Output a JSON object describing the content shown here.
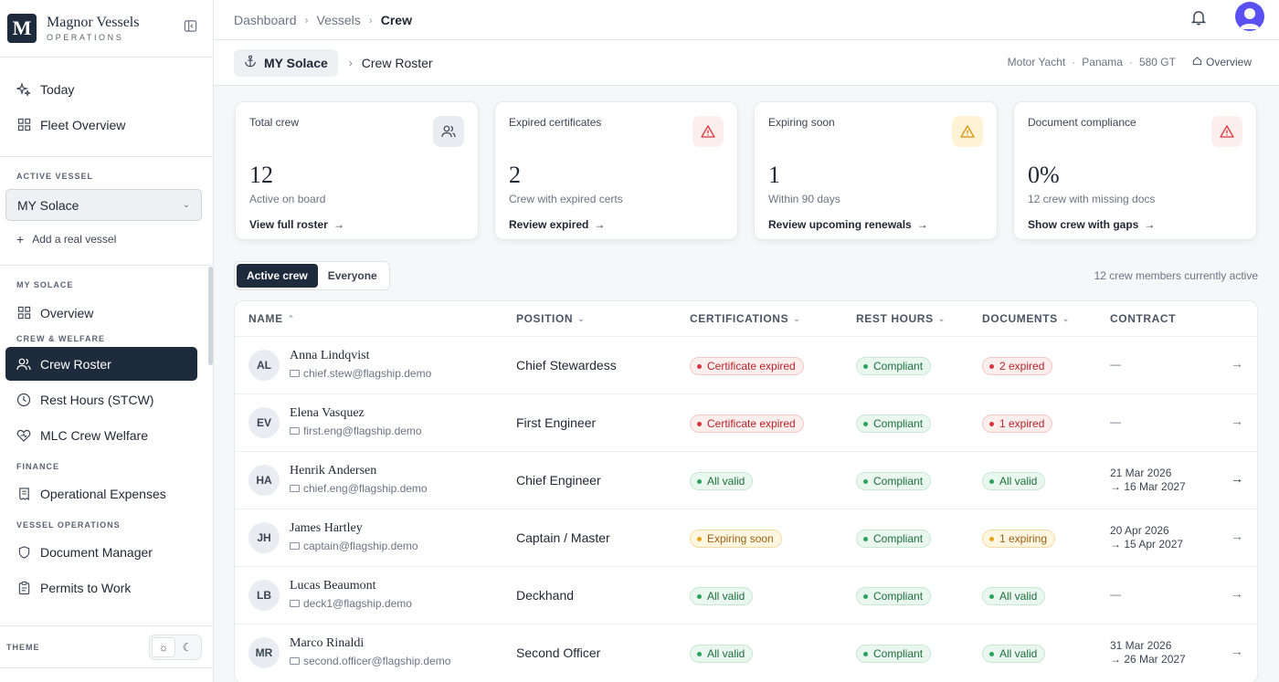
{
  "brand": {
    "name": "Magnor Vessels",
    "sub": "OPERATIONS",
    "logo_letter": "M"
  },
  "sidebar": {
    "top_items": [
      {
        "label": "Today",
        "icon": "sparkle-icon"
      },
      {
        "label": "Fleet Overview",
        "icon": "grid-icon"
      }
    ],
    "active_vessel_label": "ACTIVE VESSEL",
    "active_vessel_value": "MY Solace",
    "add_vessel": "Add a real vessel",
    "sections": [
      {
        "label": "MY SOLACE",
        "items": [
          {
            "label": "Overview",
            "icon": "grid-icon"
          }
        ]
      },
      {
        "label": "CREW & WELFARE",
        "items": [
          {
            "label": "Crew Roster",
            "icon": "users-icon",
            "active": true
          },
          {
            "label": "Rest Hours (STCW)",
            "icon": "clock-icon"
          },
          {
            "label": "MLC Crew Welfare",
            "icon": "heart-icon"
          }
        ]
      },
      {
        "label": "FINANCE",
        "items": [
          {
            "label": "Operational Expenses",
            "icon": "receipt-icon"
          }
        ]
      },
      {
        "label": "VESSEL OPERATIONS",
        "items": [
          {
            "label": "Document Manager",
            "icon": "shield-icon"
          },
          {
            "label": "Permits to Work",
            "icon": "clipboard-icon"
          }
        ]
      }
    ],
    "theme_label": "THEME"
  },
  "topbar": {
    "crumbs": [
      "Dashboard",
      "Vessels",
      "Crew"
    ]
  },
  "subbar": {
    "vessel": "MY Solace",
    "title": "Crew Roster",
    "meta": [
      "Motor Yacht",
      "Panama",
      "580 GT"
    ],
    "overview_link": "Overview"
  },
  "cards": [
    {
      "label": "Total crew",
      "value": "12",
      "sub": "Active on board",
      "link": "View full roster",
      "icon": "users-icon",
      "tone": "#e9edf2"
    },
    {
      "label": "Expired certificates",
      "value": "2",
      "sub": "Crew with expired certs",
      "link": "Review expired",
      "icon": "alert-triangle-icon",
      "tone": "#fdeeee"
    },
    {
      "label": "Expiring soon",
      "value": "1",
      "sub": "Within 90 days",
      "link": "Review upcoming renewals",
      "icon": "alert-triangle-icon",
      "tone": "#fff3d6"
    },
    {
      "label": "Document compliance",
      "value": "0%",
      "sub": "12 crew with missing docs",
      "link": "Show crew with gaps",
      "icon": "alert-triangle-icon",
      "tone": "#fdeeee"
    }
  ],
  "tabs": [
    "Active crew",
    "Everyone"
  ],
  "active_count": "12 crew members currently active",
  "table": {
    "headers": [
      "NAME",
      "POSITION",
      "CERTIFICATIONS",
      "REST HOURS",
      "DOCUMENTS",
      "CONTRACT"
    ],
    "rows": [
      {
        "initials": "AL",
        "name": "Anna Lindqvist",
        "email": "chief.stew@flagship.demo",
        "position": "Chief Stewardess",
        "cert": "Certificate expired",
        "cert_tone": "red",
        "rest": "Compliant",
        "docs": "2 expired",
        "docs_tone": "red",
        "contract_start": "",
        "contract_end": "",
        "contract_dash": "—"
      },
      {
        "initials": "EV",
        "name": "Elena Vasquez",
        "email": "first.eng@flagship.demo",
        "position": "First Engineer",
        "cert": "Certificate expired",
        "cert_tone": "red",
        "rest": "Compliant",
        "docs": "1 expired",
        "docs_tone": "red",
        "contract_start": "",
        "contract_end": "",
        "contract_dash": "—"
      },
      {
        "initials": "HA",
        "name": "Henrik Andersen",
        "email": "chief.eng@flagship.demo",
        "position": "Chief Engineer",
        "cert": "All valid",
        "cert_tone": "green",
        "rest": "Compliant",
        "docs": "All valid",
        "docs_tone": "green",
        "contract_start": "21 Mar 2026",
        "contract_end": "→ 16 Mar 2027",
        "contract_dash": ""
      },
      {
        "initials": "JH",
        "name": "James Hartley",
        "email": "captain@flagship.demo",
        "position": "Captain / Master",
        "cert": "Expiring soon",
        "cert_tone": "amber",
        "rest": "Compliant",
        "docs": "1 expiring",
        "docs_tone": "amber",
        "contract_start": "20 Apr 2026",
        "contract_end": "→ 15 Apr 2027",
        "contract_dash": ""
      },
      {
        "initials": "LB",
        "name": "Lucas Beaumont",
        "email": "deck1@flagship.demo",
        "position": "Deckhand",
        "cert": "All valid",
        "cert_tone": "green",
        "rest": "Compliant",
        "docs": "All valid",
        "docs_tone": "green",
        "contract_start": "",
        "contract_end": "",
        "contract_dash": "—"
      },
      {
        "initials": "MR",
        "name": "Marco Rinaldi",
        "email": "second.officer@flagship.demo",
        "position": "Second Officer",
        "cert": "All valid",
        "cert_tone": "green",
        "rest": "Compliant",
        "docs": "All valid",
        "docs_tone": "green",
        "contract_start": "31 Mar 2026",
        "contract_end": "→ 26 Mar 2027",
        "contract_dash": ""
      }
    ]
  },
  "colors": {
    "primary": "#1e2b3c",
    "avatar": "#5a4ff0"
  }
}
